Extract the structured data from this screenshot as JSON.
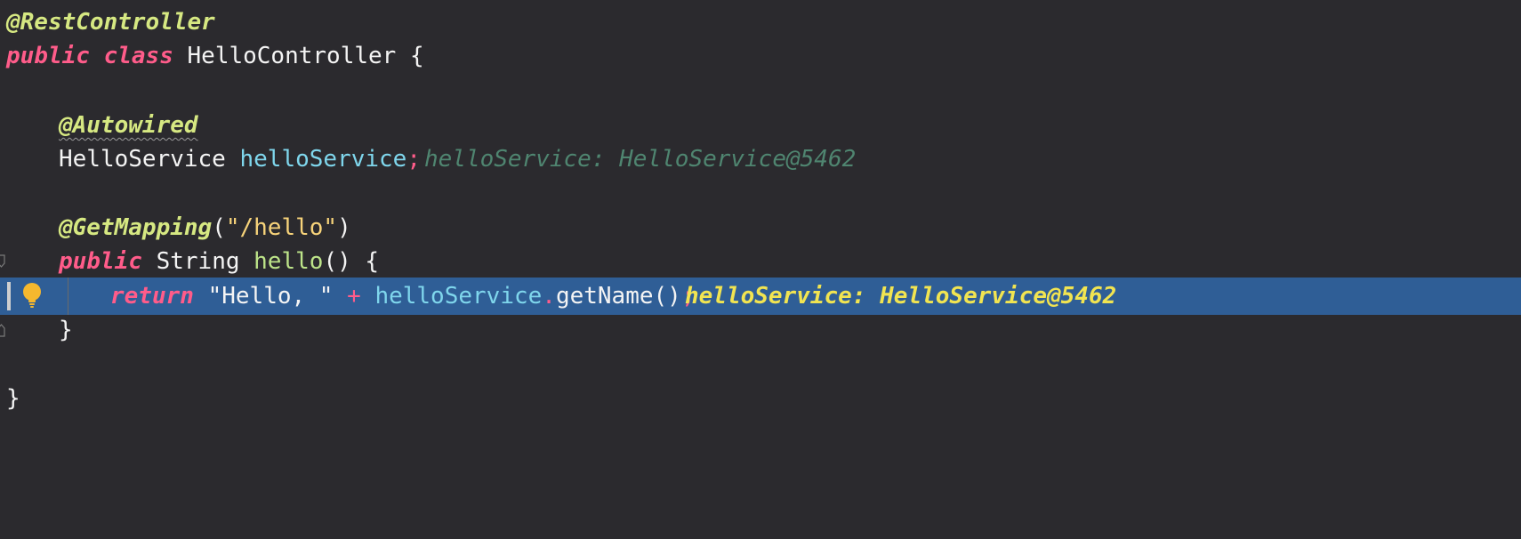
{
  "lines": {
    "l1": {
      "annotation": "@RestController"
    },
    "l2": {
      "kw_public": "public",
      "kw_class": "class",
      "class_name": "HelloController",
      "brace": "{"
    },
    "l4": {
      "annotation": "@Autowired"
    },
    "l5": {
      "type": "HelloService",
      "field": "helloService",
      "semi": ";",
      "hint": "helloService: HelloService@5462"
    },
    "l7": {
      "annotation": "@GetMapping",
      "paren_open": "(",
      "string": "\"/hello\"",
      "paren_close": ")"
    },
    "l8": {
      "kw_public": "public",
      "type": "String",
      "method": "hello",
      "parens": "()",
      "brace": "{"
    },
    "l9": {
      "kw_return": "return",
      "string": "\"Hello, \"",
      "plus": "+",
      "field": "helloService",
      "dot": ".",
      "method": "getName",
      "parens": "()",
      "semi": ";",
      "hint": "helloService: HelloService@5462"
    },
    "l10": {
      "brace": "}"
    },
    "l12": {
      "brace": "}"
    }
  },
  "icons": {
    "intention": "lightbulb-icon",
    "fold_start": "fold-start-icon",
    "fold_end": "fold-end-icon"
  },
  "colors": {
    "background": "#2b2a2e",
    "current_line": "#2f5e96",
    "keyword": "#ff5c8a",
    "annotation": "#d6e882",
    "field": "#7fd6ec",
    "string": "#f7d37a",
    "inline_hint": "#4f8570",
    "inline_hint_active": "#f1e451",
    "bulb": "#f5b82e"
  }
}
